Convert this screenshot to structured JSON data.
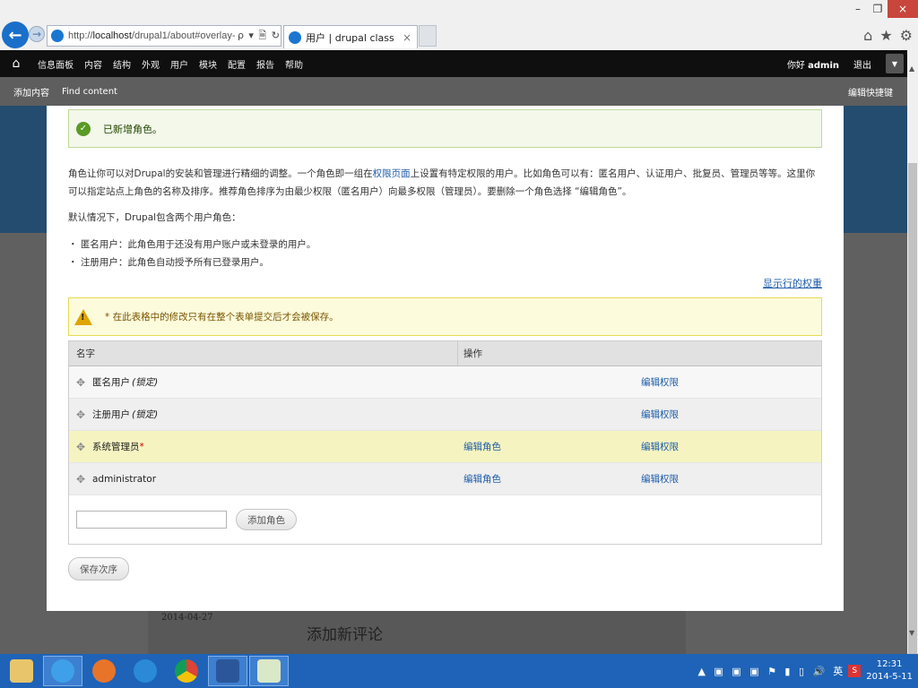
{
  "browser": {
    "url_prefix": "http://",
    "url_host": "localhost",
    "url_path": "/drupal1/about#overlay-cor",
    "addr_icons": "ρ ▾ 🗎 ↻",
    "tab_title": "用户 | drupal class",
    "tab_close": "×",
    "back_glyph": "←",
    "forward_glyph": "→",
    "win_minimize": "–",
    "win_restore": "❐",
    "win_close": "×",
    "tools": [
      "⌂",
      "★",
      "⚙"
    ]
  },
  "toolbar": {
    "home_glyph": "⌂",
    "menu": [
      "信息面板",
      "内容",
      "结构",
      "外观",
      "用户",
      "模块",
      "配置",
      "报告",
      "帮助"
    ],
    "hello_prefix": "你好 ",
    "username": "admin",
    "logout": "退出",
    "drawer_glyph": "▼"
  },
  "shortcuts": {
    "items": [
      "添加内容",
      "Find content"
    ],
    "edit": "编辑快捷键"
  },
  "status_message": {
    "icon": "check-icon",
    "text": "已新增角色。"
  },
  "intro": {
    "p1_before": "角色让你可以对Drupal的安装和管理进行精细的调整。一个角色即一组在",
    "p1_link": "权限页面",
    "p1_after": "上设置有特定权限的用户。比如角色可以有：匿名用户、认证用户、批复员、管理员等等。这里你可以指定站点上角色的名称及排序。推荐角色排序为由最少权限（匿名用户）向最多权限（管理员）。要删除一个角色选择 “编辑角色”。",
    "p2": "默认情况下，Drupal包含两个用户角色：",
    "bullets": [
      "匿名用户：此角色用于还没有用户账户或未登录的用户。",
      "注册用户：此角色自动授予所有已登录用户。"
    ]
  },
  "show_weights": "显示行的权重",
  "warning": {
    "icon_glyph": "!",
    "text": "* 在此表格中的修改只有在整个表单提交后才会被保存。"
  },
  "table": {
    "headers": [
      "名字",
      "操作"
    ],
    "rows": [
      {
        "name": "匿名用户",
        "locked": "(锁定)",
        "required": "",
        "edit_role": "",
        "edit_perm": "编辑权限"
      },
      {
        "name": "注册用户",
        "locked": "(锁定)",
        "required": "",
        "edit_role": "",
        "edit_perm": "编辑权限"
      },
      {
        "name": "系统管理员",
        "locked": "",
        "required": "*",
        "edit_role": "编辑角色",
        "edit_perm": "编辑权限"
      },
      {
        "name": "administrator",
        "locked": "",
        "required": "",
        "edit_role": "编辑角色",
        "edit_perm": "编辑权限"
      }
    ],
    "drag_glyph": "✥",
    "add_input_value": "",
    "add_button": "添加角色"
  },
  "save_button": "保存次序",
  "background": {
    "date": "2014-04-27",
    "comment_heading": "添加新评论"
  },
  "scrollbar": {
    "up": "▲",
    "down": "▼"
  },
  "taskbar": {
    "apps": [
      {
        "name": "file-explorer",
        "color": "#e8c56a"
      },
      {
        "name": "internet-explorer",
        "color": "#3fa0ea"
      },
      {
        "name": "firefox",
        "color": "#e8742a"
      },
      {
        "name": "app-s",
        "color": "#2a8ad8"
      },
      {
        "name": "chrome",
        "color": "#e8c23a"
      },
      {
        "name": "word",
        "color": "#2b579a"
      },
      {
        "name": "chart-app",
        "color": "#d9e8c6"
      }
    ],
    "tray_icons": "▲ ▣ ▣ ▣ ⚑ ▮ ▯ 🔊",
    "ime": "英",
    "s_icon": "S",
    "time": "12:31",
    "date": "2014-5-11"
  },
  "colors": {
    "link": "#1e5ca8",
    "status_green": "#5a9a26",
    "warning_yellow": "#e0a400",
    "taskbar": "#1e63b7",
    "toolbar": "#0f0f0f"
  }
}
